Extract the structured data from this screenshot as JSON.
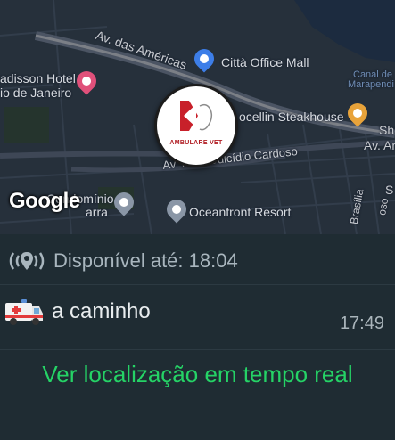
{
  "map": {
    "streets": {
      "av_americas": "Av. das Américas",
      "av_pref": "Av. Pref. Dulcídio Cardoso",
      "av_ar": "Av. Ar",
      "brasilia": "Brasília",
      "oso": "oso",
      "canal_l1": "Canal de",
      "canal_l2": "Marapendi",
      "sho": "Sho",
      "s": "S"
    },
    "pois": {
      "radisson_l1": "adisson Hotel",
      "radisson_l2": "io de Janeiro",
      "citta": "Città Office Mall",
      "steakhouse": "ocellin Steakhouse",
      "condominio_l1": "Condomínio",
      "condominio_l2": "arra",
      "oceanfront": "Oceanfront Resort"
    },
    "marker_logo": "AMBULARE VET",
    "attribution": "Google"
  },
  "status": {
    "icon": "live-location-icon",
    "text": "Disponível até: 18:04"
  },
  "caption": {
    "emoji": "ambulance-emoji",
    "text": "a caminho"
  },
  "timestamp": "17:49",
  "action": {
    "label": "Ver localização em tempo real"
  },
  "colors": {
    "accent": "#25d366",
    "bubble_bg": "#1f2c33",
    "map_bg": "#26303b"
  }
}
